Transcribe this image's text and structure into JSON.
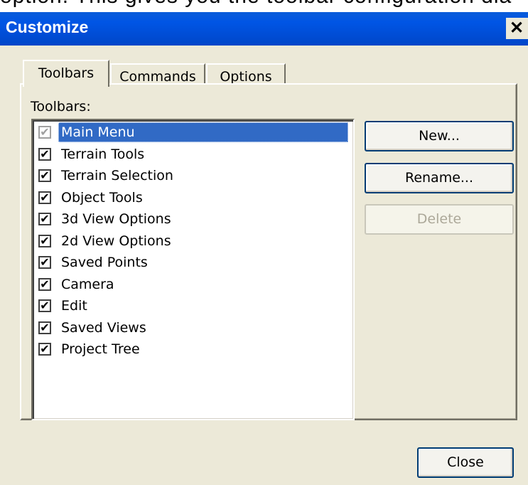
{
  "background_caption": "option. This gives you the toolbar configuration dia",
  "dialog": {
    "title": "Customize",
    "close_glyph": "✕"
  },
  "tabs": [
    {
      "label": "Toolbars",
      "active": true
    },
    {
      "label": "Commands",
      "active": false
    },
    {
      "label": "Options",
      "active": false
    }
  ],
  "toolbars": {
    "list_label": "Toolbars:",
    "items": [
      {
        "label": "Main Menu",
        "checked": true,
        "disabled": true,
        "selected": true
      },
      {
        "label": "Terrain Tools",
        "checked": true
      },
      {
        "label": "Terrain Selection",
        "checked": true
      },
      {
        "label": "Object Tools",
        "checked": true
      },
      {
        "label": "3d View Options",
        "checked": true
      },
      {
        "label": "2d View Options",
        "checked": true
      },
      {
        "label": "Saved Points",
        "checked": true
      },
      {
        "label": "Camera",
        "checked": true
      },
      {
        "label": "Edit",
        "checked": true
      },
      {
        "label": "Saved Views",
        "checked": true
      },
      {
        "label": "Project Tree",
        "checked": true
      }
    ],
    "check_glyph": "✔"
  },
  "buttons": {
    "new": "New...",
    "rename": "Rename...",
    "delete": "Delete",
    "close": "Close"
  },
  "colors": {
    "titlebar": "#0055e5",
    "dialog_bg": "#ece9d8",
    "selection": "#316ac5"
  }
}
